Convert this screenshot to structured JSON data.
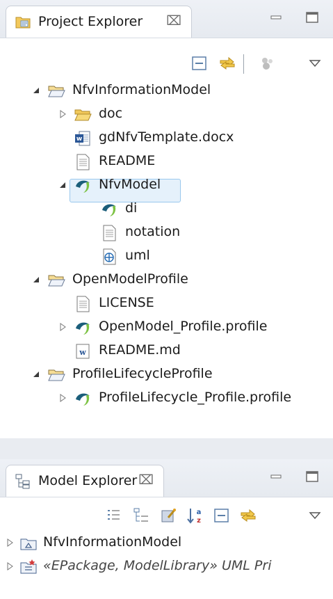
{
  "project_explorer": {
    "tab_label": "Project Explorer",
    "close_glyph": "⌧",
    "tree": [
      {
        "label": "NfvInformationModel",
        "icon": "open-folder-icon",
        "expander": "expanded"
      },
      {
        "label": "doc",
        "icon": "folder-icon",
        "expander": "collapsed"
      },
      {
        "label": "gdNfvTemplate.docx",
        "icon": "word-document-icon",
        "expander": "none"
      },
      {
        "label": "README",
        "icon": "text-file-icon",
        "expander": "none"
      },
      {
        "label": "NfvModel",
        "icon": "papyrus-model-icon",
        "expander": "expanded",
        "selected": true
      },
      {
        "label": "di",
        "icon": "papyrus-model-icon",
        "expander": "none"
      },
      {
        "label": "notation",
        "icon": "text-file-icon",
        "expander": "none"
      },
      {
        "label": "uml",
        "icon": "uml-file-icon",
        "expander": "none"
      },
      {
        "label": "OpenModelProfile",
        "icon": "open-folder-icon",
        "expander": "expanded"
      },
      {
        "label": "LICENSE",
        "icon": "text-file-icon",
        "expander": "none"
      },
      {
        "label": "OpenModel_Profile.profile",
        "icon": "papyrus-model-icon",
        "expander": "collapsed"
      },
      {
        "label": "README.md",
        "icon": "markdown-file-icon",
        "expander": "none"
      },
      {
        "label": "ProfileLifecycleProfile",
        "icon": "open-folder-icon",
        "expander": "expanded"
      },
      {
        "label": "ProfileLifecycle_Profile.profile",
        "icon": "papyrus-model-icon",
        "expander": "collapsed"
      }
    ]
  },
  "model_explorer": {
    "tab_label": "Model Explorer",
    "close_glyph": "⌧",
    "tree": [
      {
        "label": "NfvInformationModel",
        "icon": "uml-model-icon",
        "expander": "collapsed"
      },
      {
        "label": "«EPackage, ModelLibrary» UML Pri",
        "icon": "model-library-icon",
        "expander": "collapsed",
        "italic": true
      }
    ]
  },
  "colors": {
    "selection_bg": "#e5f1fb",
    "selection_border": "#99c7ed",
    "folder": "#f3c95c",
    "papyrus_green": "#7cc242",
    "papyrus_dark": "#1b5e7a"
  }
}
